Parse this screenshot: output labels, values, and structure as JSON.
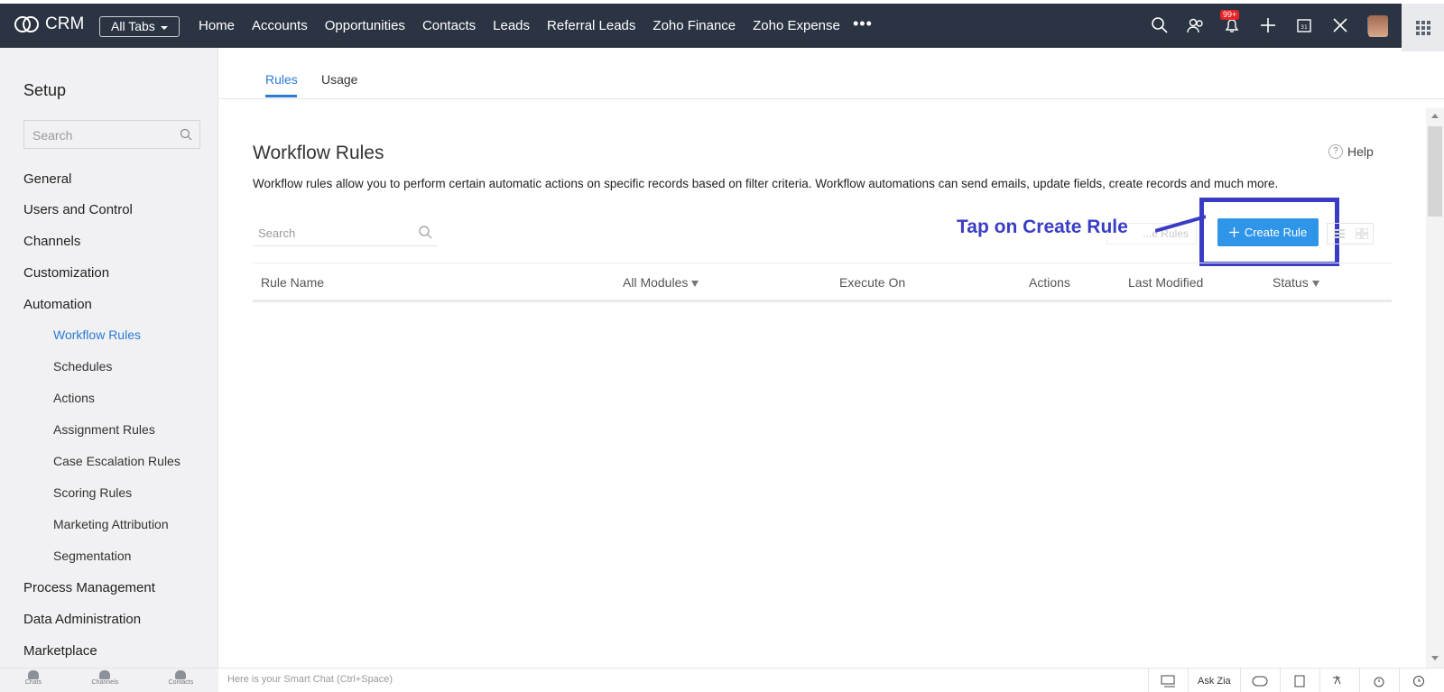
{
  "topnav": {
    "brand": "CRM",
    "all_tabs": "All Tabs",
    "links": [
      "Home",
      "Accounts",
      "Opportunities",
      "Contacts",
      "Leads",
      "Referral Leads",
      "Zoho Finance",
      "Zoho Expense"
    ],
    "more": "•••",
    "notification_count": "99+"
  },
  "sidebar": {
    "title": "Setup",
    "search_placeholder": "Search",
    "sections": [
      "General",
      "Users and Control",
      "Channels",
      "Customization",
      "Automation"
    ],
    "automation_items": [
      "Workflow Rules",
      "Schedules",
      "Actions",
      "Assignment Rules",
      "Case Escalation Rules",
      "Scoring Rules",
      "Marketing Attribution",
      "Segmentation"
    ],
    "more_sections": [
      "Process Management",
      "Data Administration",
      "Marketplace"
    ]
  },
  "tabs": [
    "Rules",
    "Usage"
  ],
  "main": {
    "title": "Workflow Rules",
    "help": "Help",
    "description": "Workflow rules allow you to perform certain automatic actions on specific records based on filter criteria. Workflow automations can send emails, update fields, create records and much more.",
    "search_placeholder": "Search",
    "annotation": "Tap on Create Rule",
    "faded_search": "...e Rules",
    "create_button": "Create Rule",
    "columns": [
      "Rule Name",
      "All Modules",
      "Execute On",
      "Actions",
      "Last Modified",
      "Status"
    ]
  },
  "bottombar": {
    "items": [
      "Chats",
      "Channels",
      "Contacts"
    ],
    "smartchat": "Here is your Smart Chat (Ctrl+Space)",
    "ask_zia": "Ask Zia"
  },
  "colors": {
    "nav_bg": "#2b3443",
    "accent": "#2a7bd3",
    "button": "#2f95e9",
    "annotation": "#3a3dc4"
  }
}
